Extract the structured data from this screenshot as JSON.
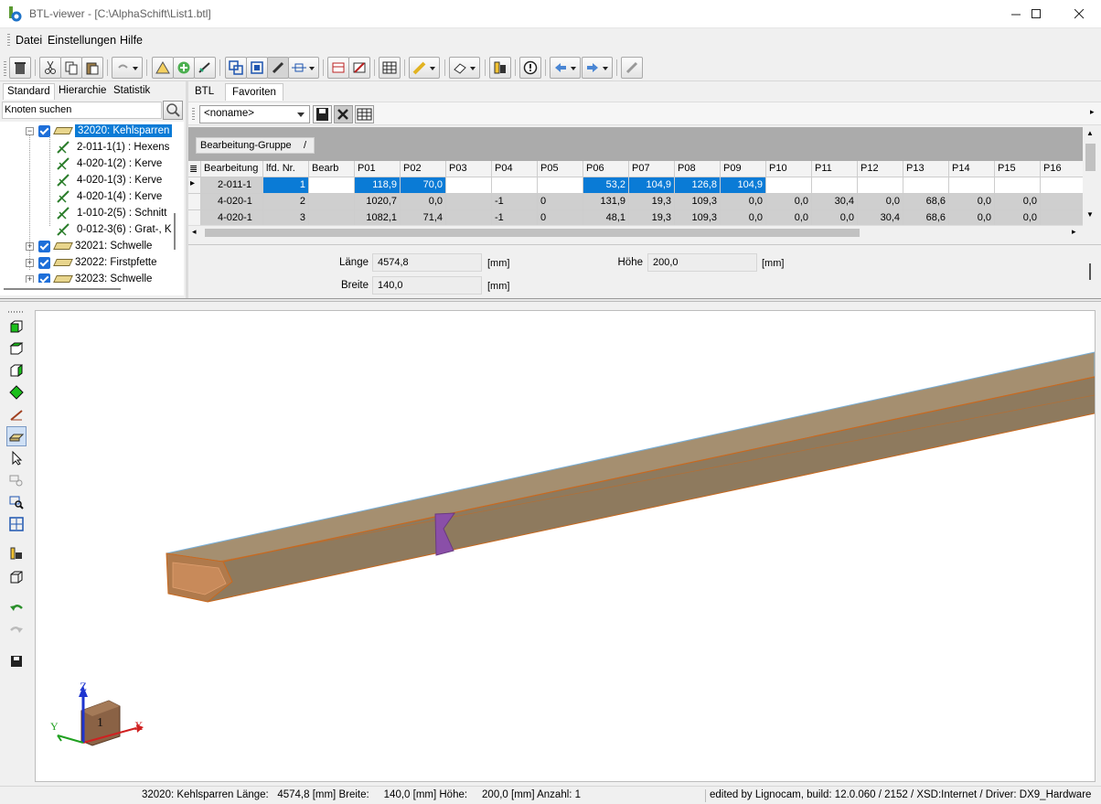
{
  "window": {
    "title": "BTL-viewer - [C:\\AlphaSchift\\List1.btl]",
    "minimize_icon": "minimize-icon",
    "maximize_icon": "maximize-icon",
    "close_icon": "close-icon"
  },
  "menu": {
    "items": [
      "Datei",
      "Einstellungen",
      "Hilfe"
    ]
  },
  "left_panel": {
    "tabs": [
      "Standard",
      "Hierarchie",
      "Statistik"
    ],
    "search_placeholder": "Knoten suchen",
    "tree": {
      "selected": "32020: Kehlsparren",
      "children": [
        "2-011-1(1) : Hexens",
        "4-020-1(2) : Kerve",
        "4-020-1(3) : Kerve",
        "4-020-1(4) : Kerve",
        "1-010-2(5) : Schnitt",
        "0-012-3(6) : Grat-, K"
      ],
      "siblings": [
        "32021: Schwelle",
        "32022: Firstpfette",
        "32023: Schwelle"
      ]
    }
  },
  "right_panel": {
    "tabs": [
      "BTL",
      "Favoriten"
    ],
    "favorites_select": "<noname>",
    "group_panel": "Bearbeitung-Gruppe",
    "group_sort": "/",
    "grid": {
      "columns": [
        "Bearbeitung",
        "lfd. Nr.",
        "Bearb",
        "P01",
        "P02",
        "P03",
        "P04",
        "P05",
        "P06",
        "P07",
        "P08",
        "P09",
        "P10",
        "P11",
        "P12",
        "P13",
        "P14",
        "P15",
        "P16"
      ],
      "rows": [
        [
          "2-011-1",
          "1",
          "",
          "118,9",
          "70,0",
          "",
          "",
          "",
          "53,2",
          "104,9",
          "126,8",
          "104,9",
          "",
          "",
          "",
          "",
          "",
          "",
          ""
        ],
        [
          "4-020-1",
          "2",
          "",
          "1020,7",
          "0,0",
          "",
          "-1",
          "0",
          "131,9",
          "19,3",
          "109,3",
          "0,0",
          "0,0",
          "30,4",
          "0,0",
          "68,6",
          "0,0",
          "0,0",
          ""
        ],
        [
          "4-020-1",
          "3",
          "",
          "1082,1",
          "71,4",
          "",
          "-1",
          "0",
          "48,1",
          "19,3",
          "109,3",
          "0,0",
          "0,0",
          "0,0",
          "30,4",
          "68,6",
          "0,0",
          "0,0",
          ""
        ]
      ]
    },
    "properties": {
      "laenge_label": "Länge",
      "laenge_value": "4574,8",
      "breite_label": "Breite",
      "breite_value": "140,0",
      "hoehe_label": "Höhe",
      "hoehe_value": "200,0",
      "unit": "[mm]"
    }
  },
  "viewport": {
    "axis_z": "Z",
    "axis_y": "Y",
    "axis_x": "X",
    "cube_label": "1"
  },
  "statusbar": {
    "left": "32020: Kehlsparren Länge:   4574,8 [mm] Breite:     140,0 [mm] Höhe:     200,0 [mm] Anzahl: 1",
    "right": "edited by Lignocam, build: 12.0.060 / 2152 / XSD:Internet / Driver: DX9_Hardware"
  },
  "colors": {
    "accent": "#0a7bd6",
    "beam": "#9b8262",
    "beam_edge": "#c9691e"
  }
}
